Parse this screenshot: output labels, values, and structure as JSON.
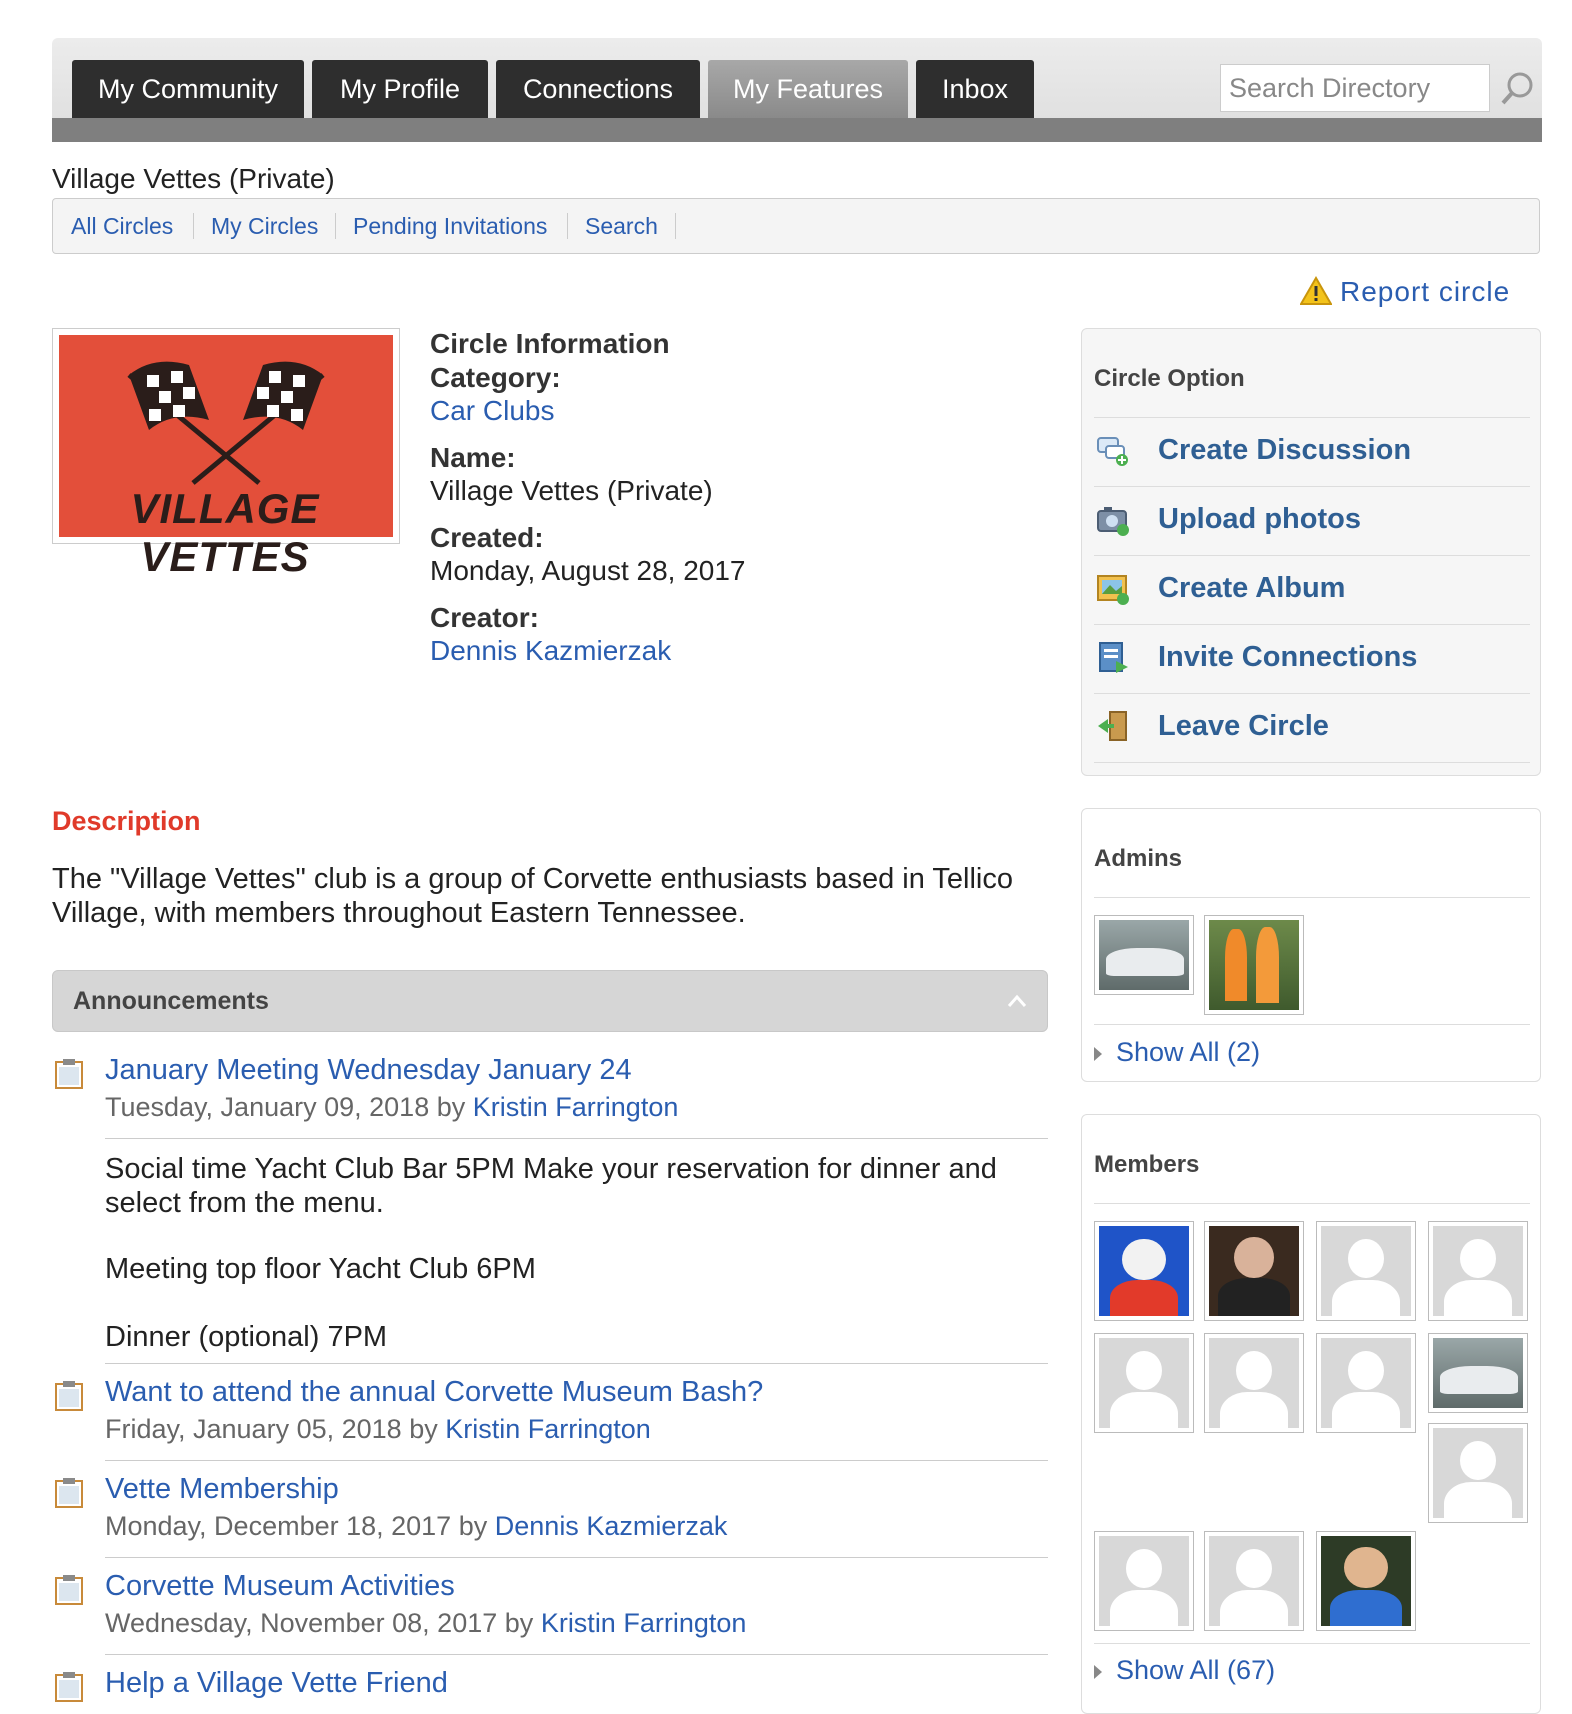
{
  "nav": {
    "tabs": [
      {
        "label": "My Community"
      },
      {
        "label": "My Profile"
      },
      {
        "label": "Connections"
      },
      {
        "label": "My Features"
      },
      {
        "label": "Inbox"
      }
    ],
    "search_placeholder": "Search Directory"
  },
  "page_title": "Village Vettes (Private)",
  "subnav": [
    "All Circles",
    "My Circles",
    "Pending Invitations",
    "Search"
  ],
  "report_label": "Report circle",
  "logo_text": "VILLAGE VETTES",
  "info": {
    "heading": "Circle Information",
    "category_label": "Category:",
    "category_value": "Car Clubs",
    "name_label": "Name:",
    "name_value": "Village Vettes (Private)",
    "created_label": "Created:",
    "created_value": "Monday, August 28, 2017",
    "creator_label": "Creator:",
    "creator_value": "Dennis Kazmierzak"
  },
  "circle_option": {
    "heading": "Circle Option",
    "items": [
      {
        "label": "Create Discussion",
        "icon": "discussion-icon"
      },
      {
        "label": "Upload photos",
        "icon": "camera-icon"
      },
      {
        "label": "Create Album",
        "icon": "album-icon"
      },
      {
        "label": "Invite Connections",
        "icon": "invite-icon"
      },
      {
        "label": "Leave Circle",
        "icon": "leave-icon"
      }
    ]
  },
  "admins": {
    "heading": "Admins",
    "show_all": "Show All (2)"
  },
  "members": {
    "heading": "Members",
    "show_all": "Show All (67)"
  },
  "description": {
    "heading": "Description",
    "text": "The \"Village Vettes\" club is a group of Corvette enthusiasts based in Tellico Village, with members throughout Eastern Tennessee."
  },
  "announcements": {
    "heading": "Announcements",
    "items": [
      {
        "title": "January Meeting Wednesday January 24",
        "date": "Tuesday, January 09, 2018",
        "by": "by",
        "author": "Kristin Farrington",
        "body": [
          "Social time Yacht Club Bar 5PM Make your reservation for dinner and select from the menu.",
          "Meeting top floor Yacht Club 6PM",
          "Dinner (optional) 7PM"
        ]
      },
      {
        "title": "Want to attend the annual Corvette Museum Bash?",
        "date": "Friday, January 05, 2018",
        "by": "by",
        "author": "Kristin Farrington"
      },
      {
        "title": "Vette Membership",
        "date": "Monday, December 18, 2017",
        "by": "by",
        "author": "Dennis Kazmierzak"
      },
      {
        "title": "Corvette Museum Activities",
        "date": "Wednesday, November 08, 2017",
        "by": "by",
        "author": "Kristin Farrington"
      },
      {
        "title": "Help a Village Vette Friend"
      }
    ]
  }
}
